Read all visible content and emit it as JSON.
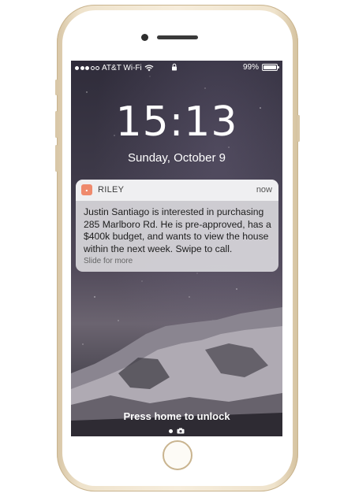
{
  "status_bar": {
    "carrier": "AT&T Wi-Fi",
    "signal_bars_filled": 3,
    "signal_bars_total": 5,
    "battery_percent": "99%",
    "battery_level": 0.99
  },
  "lock_screen": {
    "time": "15:13",
    "date": "Sunday, October 9",
    "unlock_hint": "Press home to unlock"
  },
  "notification": {
    "app_name": "RILEY",
    "time": "now",
    "message": "Justin Santiago is interested in purchasing 285 Marlboro Rd. He is pre-approved, has a $400k budget, and wants to view the house within the next week. Swipe to call.",
    "action_hint": "Slide for more",
    "app_icon_color": "#ef8a6d"
  },
  "icons": {
    "wifi": "wifi-icon",
    "lock": "lock-icon",
    "battery": "battery-icon",
    "camera": "camera-icon"
  }
}
